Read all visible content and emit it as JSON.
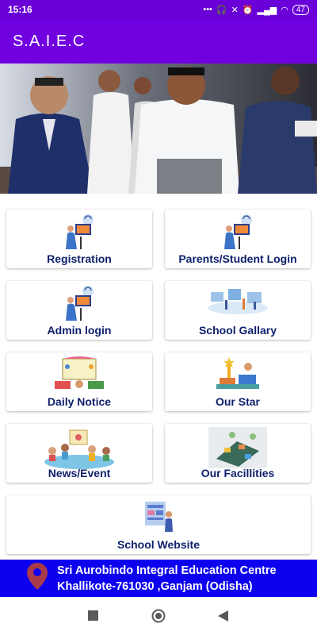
{
  "status": {
    "time": "15:16",
    "dots": "•••",
    "battery": "47"
  },
  "app": {
    "title": "S.A.I.E.C"
  },
  "tiles": [
    {
      "label": "Registration",
      "icon": "user-computer-icon"
    },
    {
      "label": "Parents/Student Login",
      "icon": "user-computer-icon"
    },
    {
      "label": "Admin login",
      "icon": "user-computer-icon"
    },
    {
      "label": "School Gallary",
      "icon": "gallery-icon"
    },
    {
      "label": "Daily Notice",
      "icon": "notice-icon"
    },
    {
      "label": "Our Star",
      "icon": "star-books-icon"
    },
    {
      "label": "News/Event",
      "icon": "news-event-icon"
    },
    {
      "label": "Our Facillities",
      "icon": "facilities-icon"
    },
    {
      "label": "School Website",
      "icon": "website-icon"
    }
  ],
  "footer": {
    "line1": "Sri Aurobindo Integral Education Centre",
    "line2": "Khallikote-761030 ,Ganjam (Odisha)",
    "icon": "location-pin-icon"
  },
  "colors": {
    "status_bar": "#6a00d8",
    "app_bar": "#7000e0",
    "footer": "#0c00ee",
    "label": "#0d1f6b"
  }
}
